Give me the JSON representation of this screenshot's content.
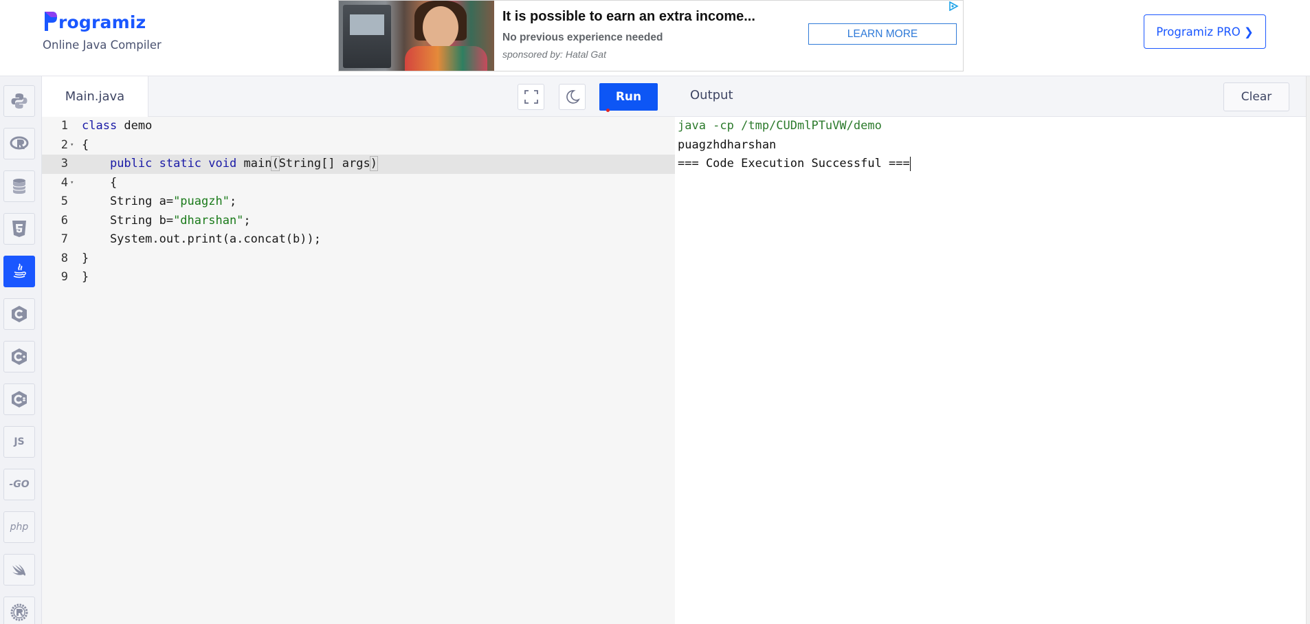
{
  "header": {
    "brand_name": "rogramiz",
    "brand_subtitle": "Online Java Compiler",
    "pro_button": "Programiz PRO ❯"
  },
  "ad": {
    "title": "It is possible to earn an extra income...",
    "subtitle": "No previous experience needed",
    "sponsor": "sponsored by: Hatal Gat",
    "cta": "LEARN MORE"
  },
  "sidebar": {
    "languages": [
      {
        "name": "python-icon"
      },
      {
        "name": "r-icon"
      },
      {
        "name": "sql-icon"
      },
      {
        "name": "html5-icon"
      },
      {
        "name": "java-icon",
        "active": true
      },
      {
        "name": "c-icon"
      },
      {
        "name": "cplusplus-icon"
      },
      {
        "name": "csharp-icon"
      },
      {
        "name": "javascript-icon",
        "text": "JS"
      },
      {
        "name": "go-icon",
        "text": "-GO"
      },
      {
        "name": "php-icon",
        "text": "php"
      },
      {
        "name": "swift-icon"
      },
      {
        "name": "rust-icon"
      }
    ]
  },
  "editor": {
    "file_tab": "Main.java",
    "run_label": "Run",
    "line_numbers": [
      "1",
      "2",
      "3",
      "4",
      "5",
      "6",
      "7",
      "8",
      "9"
    ],
    "lines": [
      "class demo",
      "{",
      "    public static void main(String[] args)",
      "    {",
      "    String a=\"puagzh\";",
      "    String b=\"dharshan\";",
      "    System.out.print(a.concat(b));",
      "}",
      "}"
    ],
    "active_line": 3
  },
  "output": {
    "title": "Output",
    "clear_label": "Clear",
    "command": "java -cp /tmp/CUDmlPTuVW/demo",
    "result": "puagzhdharshan",
    "status": "=== Code Execution Successful ==="
  },
  "colors": {
    "brand_blue": "#1a57ff",
    "run_blue": "#0d56f5",
    "keyword": "#1a1aa6",
    "string": "#1a7a1a"
  }
}
